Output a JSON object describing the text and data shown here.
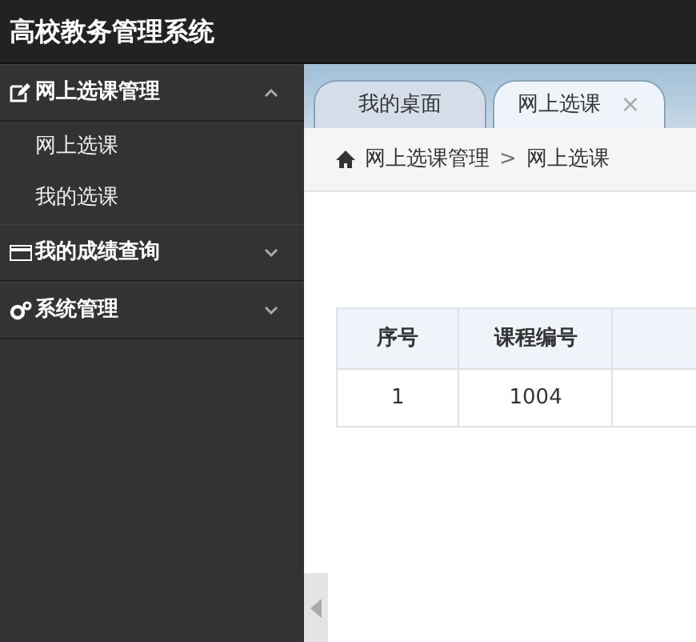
{
  "app_title": "高校教务管理系统",
  "sidebar": {
    "groups": [
      {
        "label": "网上选课管理",
        "expanded": true,
        "children": [
          {
            "label": "网上选课"
          },
          {
            "label": "我的选课"
          }
        ]
      },
      {
        "label": "我的成绩查询",
        "expanded": false
      },
      {
        "label": "系统管理",
        "expanded": false
      }
    ]
  },
  "tabs": [
    {
      "label": "我的桌面",
      "selected": false
    },
    {
      "label": "网上选课",
      "selected": true,
      "close": "×"
    }
  ],
  "breadcrumb": [
    "网上选课管理",
    "网上选课"
  ],
  "breadcrumb_separator": ">",
  "table": {
    "columns": [
      "序号",
      "课程编号"
    ],
    "rows": [
      [
        "1",
        "1004"
      ]
    ]
  }
}
